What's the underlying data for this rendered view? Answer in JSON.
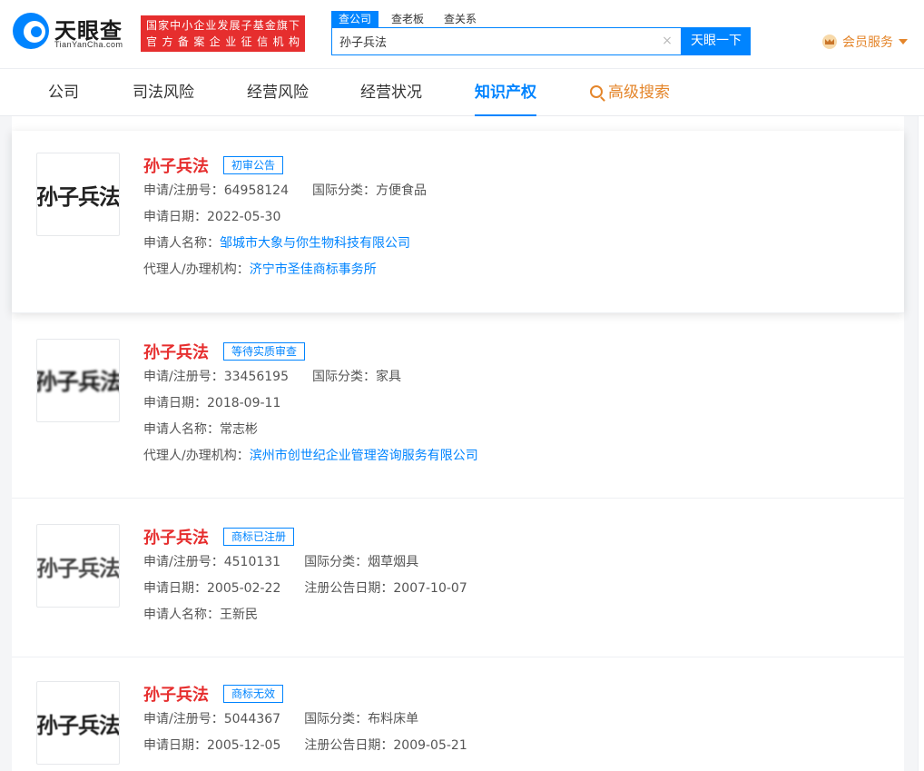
{
  "header": {
    "logo_title": "天眼查",
    "logo_sub": "TianYanCha.com",
    "slogan_line1": "国家中小企业发展子基金旗下",
    "slogan_line2": "官方备案企业征信机构",
    "search_tabs": [
      "查公司",
      "查老板",
      "查关系"
    ],
    "search_value": "孙子兵法",
    "search_button": "天眼一下",
    "clear_glyph": "×",
    "vip_label": "会员服务"
  },
  "nav": {
    "items": [
      "公司",
      "司法风险",
      "经营风险",
      "经营状况",
      "知识产权"
    ],
    "advanced": "高级搜索",
    "active_index": 4
  },
  "labels": {
    "reg_no": "申请/注册号：",
    "intl_class": "国际分类：",
    "apply_date": "申请日期：",
    "applicant": "申请人名称：",
    "agent": "代理人/办理机构：",
    "reg_notice_date": "注册公告日期："
  },
  "results": [
    {
      "thumb_text": "孙子兵法",
      "name": "孙子兵法",
      "status": "初审公告",
      "reg_no": "64958124",
      "intl_class": "方便食品",
      "apply_date": "2022-05-30",
      "applicant": "邹城市大象与你生物科技有限公司",
      "agent": "济宁市圣佳商标事务所"
    },
    {
      "thumb_text": "孙子兵法",
      "name": "孙子兵法",
      "status": "等待实质审查",
      "reg_no": "33456195",
      "intl_class": "家具",
      "apply_date": "2018-09-11",
      "applicant": "常志彬",
      "agent": "滨州市创世纪企业管理咨询服务有限公司"
    },
    {
      "thumb_text": "孙子兵法",
      "name": "孙子兵法",
      "status": "商标已注册",
      "reg_no": "4510131",
      "intl_class": "烟草烟具",
      "apply_date": "2005-02-22",
      "reg_notice_date": "2007-10-07",
      "applicant": "王新民"
    },
    {
      "thumb_text": "孙子兵法",
      "name": "孙子兵法",
      "status": "商标无效",
      "reg_no": "5044367",
      "intl_class": "布料床单",
      "apply_date": "2005-12-05",
      "reg_notice_date": "2009-05-21"
    }
  ]
}
